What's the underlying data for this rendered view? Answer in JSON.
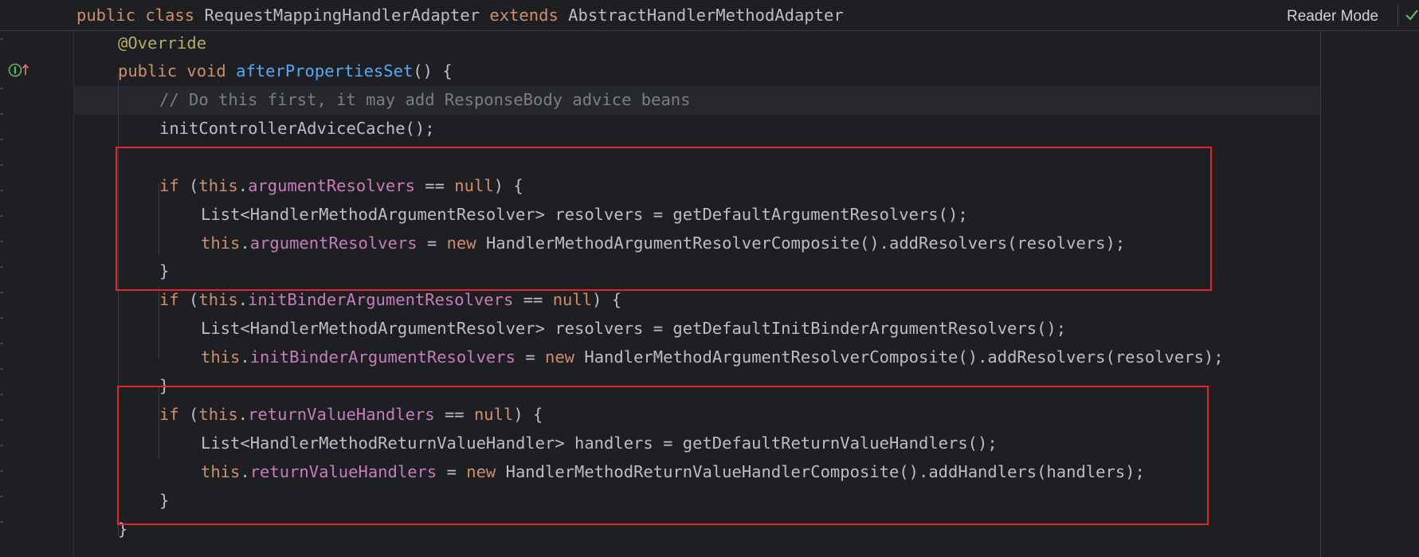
{
  "header": {
    "reader_mode_label": "Reader Mode",
    "class_line": {
      "kw1": "public",
      "kw2": "class",
      "class_name": "RequestMappingHandlerAdapter",
      "kw3": "extends",
      "super_name": "AbstractHandlerMethodAdapter"
    }
  },
  "gutter": {
    "icon": "implementation-up-arrow-icon"
  },
  "code": {
    "override": "@Override",
    "m_public": "public",
    "m_void": "void",
    "m_name": "afterPropertiesSet",
    "m_sig": "() {",
    "comment": "// Do this first, it may add ResponseBody advice beans",
    "init_call": "initControllerAdviceCache();",
    "b1": {
      "kw_if": "if",
      "open": "(",
      "this": "this",
      "dot": ".",
      "field": "argumentResolvers",
      "eq": "==",
      "null": "null",
      "close": ") {",
      "l1": "List<HandlerMethodArgumentResolver> resolvers = getDefaultArgumentResolvers();",
      "l2_this": "this",
      "l2_dot": ".",
      "l2_field": "argumentResolvers",
      "l2_eq": "=",
      "l2_new": "new",
      "l2_rest": "HandlerMethodArgumentResolverComposite().addResolvers(resolvers);",
      "end": "}"
    },
    "b2": {
      "kw_if": "if",
      "open": "(",
      "this": "this",
      "dot": ".",
      "field": "initBinderArgumentResolvers",
      "eq": "==",
      "null": "null",
      "close": ") {",
      "l1": "List<HandlerMethodArgumentResolver> resolvers = getDefaultInitBinderArgumentResolvers();",
      "l2_this": "this",
      "l2_dot": ".",
      "l2_field": "initBinderArgumentResolvers",
      "l2_eq": "=",
      "l2_new": "new",
      "l2_rest": "HandlerMethodArgumentResolverComposite().addResolvers(resolvers);",
      "end": "}"
    },
    "b3": {
      "kw_if": "if",
      "open": "(",
      "this": "this",
      "dot": ".",
      "field": "returnValueHandlers",
      "eq": "==",
      "null": "null",
      "close": ") {",
      "l1": "List<HandlerMethodReturnValueHandler> handlers = getDefaultReturnValueHandlers();",
      "l2_this": "this",
      "l2_dot": ".",
      "l2_field": "returnValueHandlers",
      "l2_eq": "=",
      "l2_new": "new",
      "l2_rest": "HandlerMethodReturnValueHandlerComposite().addHandlers(handlers);",
      "end": "}"
    },
    "method_end": "}"
  },
  "colors": {
    "background": "#1e1f22",
    "keyword": "#cf8e6d",
    "field": "#c77dbb",
    "annotation": "#b3ae60",
    "method": "#56a8f5",
    "comment": "#7a7e85",
    "text": "#bcbec4",
    "highlight_box": "#e3242b"
  }
}
